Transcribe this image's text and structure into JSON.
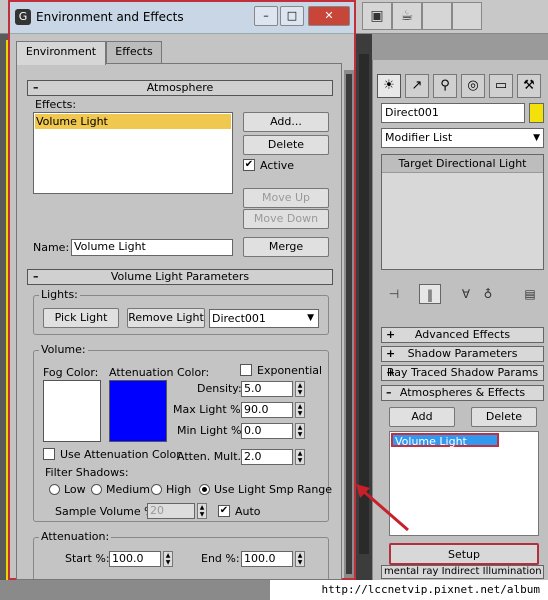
{
  "dialog": {
    "title": "Environment and Effects",
    "minimize": "–",
    "maximize": "□",
    "close": "✕",
    "tabs": [
      "Environment",
      "Effects"
    ],
    "atmosphere": {
      "header": "Atmosphere",
      "effects_label": "Effects:",
      "effects": [
        "Volume Light"
      ],
      "buttons": {
        "add": "Add...",
        "delete": "Delete",
        "move_up": "Move Up",
        "move_down": "Move Down",
        "merge": "Merge"
      },
      "active_label": "Active",
      "active_checked": true,
      "name_label": "Name:",
      "name_value": "Volume Light"
    },
    "vlp": {
      "header": "Volume Light Parameters",
      "lights_label": "Lights:",
      "pick_light": "Pick Light",
      "remove_light": "Remove Light",
      "light_dropdown": "Direct001",
      "volume_label": "Volume:",
      "fog_color_label": "Fog Color:",
      "attenuation_color_label": "Attenuation Color:",
      "fog_color": "#ffffff",
      "attenuation_color": "#0000ff",
      "exponential_label": "Exponential",
      "exponential_checked": false,
      "density_label": "Density:",
      "density": "5.0",
      "max_light_label": "Max Light %:",
      "max_light": "90.0",
      "min_light_label": "Min Light %:",
      "min_light": "0.0",
      "use_atten_label": "Use Attenuation Color",
      "use_atten_checked": false,
      "atten_mult_label": "Atten. Mult.:",
      "atten_mult": "2.0",
      "filter_shadows_label": "Filter Shadows:",
      "filter_options": [
        "Low",
        "Medium",
        "High",
        "Use Light Smp Range"
      ],
      "filter_selected": "Use Light Smp Range",
      "sample_volume_label": "Sample Volume %:",
      "sample_volume": "20",
      "auto_label": "Auto",
      "auto_checked": true,
      "attenuation_label": "Attenuation:",
      "start_label": "Start %:",
      "start": "100.0",
      "end_label": "End %:",
      "end": "100.0"
    }
  },
  "command_panel": {
    "object_name": "Direct001",
    "object_color": "#f2e20a",
    "modifier_list": "Modifier List",
    "stack_item": "Target Directional Light",
    "rollouts": [
      "Advanced Effects",
      "Shadow Parameters",
      "Ray Traced Shadow Params",
      "Atmospheres & Effects"
    ],
    "rollout_signs": [
      "+",
      "+",
      "+",
      "–"
    ],
    "add_button": "Add",
    "delete_button": "Delete",
    "effects": [
      "Volume Light"
    ],
    "setup_button": "Setup",
    "mental_ray": "mental ray Indirect Illumination"
  },
  "watermark": "http://lccnetvip.pixnet.net/album"
}
